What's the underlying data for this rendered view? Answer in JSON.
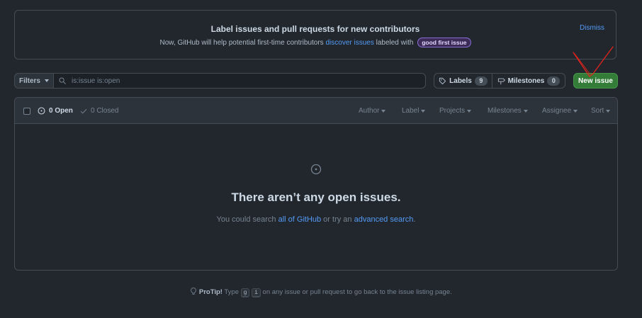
{
  "banner": {
    "title": "Label issues and pull requests for new contributors",
    "text_before": "Now, GitHub will help potential first-time contributors ",
    "link": "discover issues",
    "text_after": " labeled with",
    "label": "good first issue",
    "dismiss": "Dismiss"
  },
  "toolbar": {
    "filters_label": "Filters",
    "search_value": "is:issue is:open",
    "labels_label": "Labels",
    "labels_count": "9",
    "milestones_label": "Milestones",
    "milestones_count": "0",
    "new_issue_label": "New issue"
  },
  "issues_header": {
    "open": "0 Open",
    "closed": "0 Closed",
    "filters": [
      "Author",
      "Label",
      "Projects",
      "Milestones",
      "Assignee",
      "Sort"
    ]
  },
  "blankslate": {
    "title": "There aren’t any open issues.",
    "text_1": "You could search ",
    "link_1": "all of GitHub",
    "text_2": " or try an ",
    "link_2": "advanced search",
    "text_3": "."
  },
  "protip": {
    "label": "ProTip!",
    "text_1": " Type ",
    "key_1": "g",
    "key_2": "i",
    "text_2": " on any issue or pull request to go back to the issue listing page."
  },
  "colors": {
    "background": "#22272e",
    "accent_link": "#539bf5",
    "primary_button": "#347d39",
    "annotation": "#e5231b"
  }
}
